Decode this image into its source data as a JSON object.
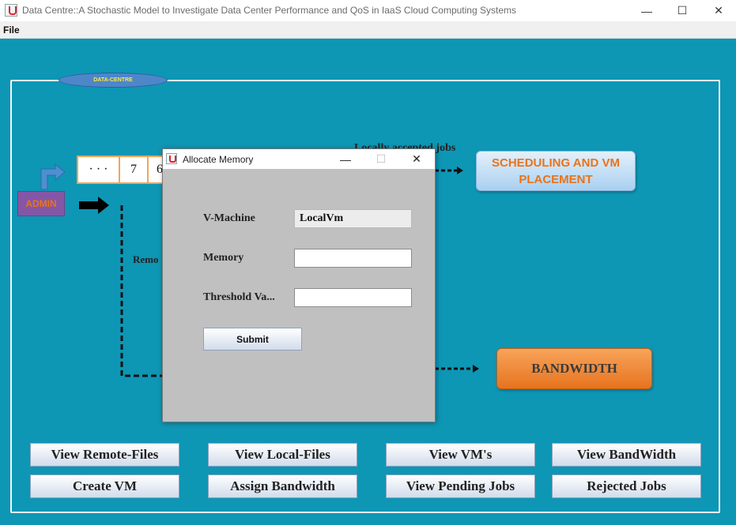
{
  "window": {
    "title": "Data Centre::A Stochastic Model to Investigate Data Center Performance and QoS in IaaS Cloud Computing Systems",
    "minimize": "—",
    "maximize": "☐",
    "close": "✕"
  },
  "menu": {
    "file": "File"
  },
  "panel": {
    "title": "DATA-CENTRE"
  },
  "diagram": {
    "queue": [
      "· · ·",
      "7",
      "6"
    ],
    "admin_label": "ADMIN",
    "local_jobs_label": "Locally accepted jobs",
    "remote_label": "Remo",
    "scheduling_label_line1": "SCHEDULING  AND VM",
    "scheduling_label_line2": "PLACEMENT",
    "bandwidth_label": "BANDWIDTH"
  },
  "buttons": [
    "View Remote-Files",
    "View Local-Files",
    "View VM's",
    "View BandWidth",
    "Create VM",
    "Assign Bandwidth",
    "View Pending Jobs",
    "Rejected Jobs"
  ],
  "dialog": {
    "title": "Allocate Memory",
    "vm_label": "V-Machine",
    "vm_value": "LocalVm",
    "memory_label": "Memory",
    "memory_value": "",
    "threshold_label": "Threshold Va...",
    "threshold_value": "",
    "submit": "Submit"
  },
  "colors": {
    "background": "#0e96b5",
    "accent_orange": "#e8731c",
    "dialog_bg": "#c0c0c0"
  }
}
